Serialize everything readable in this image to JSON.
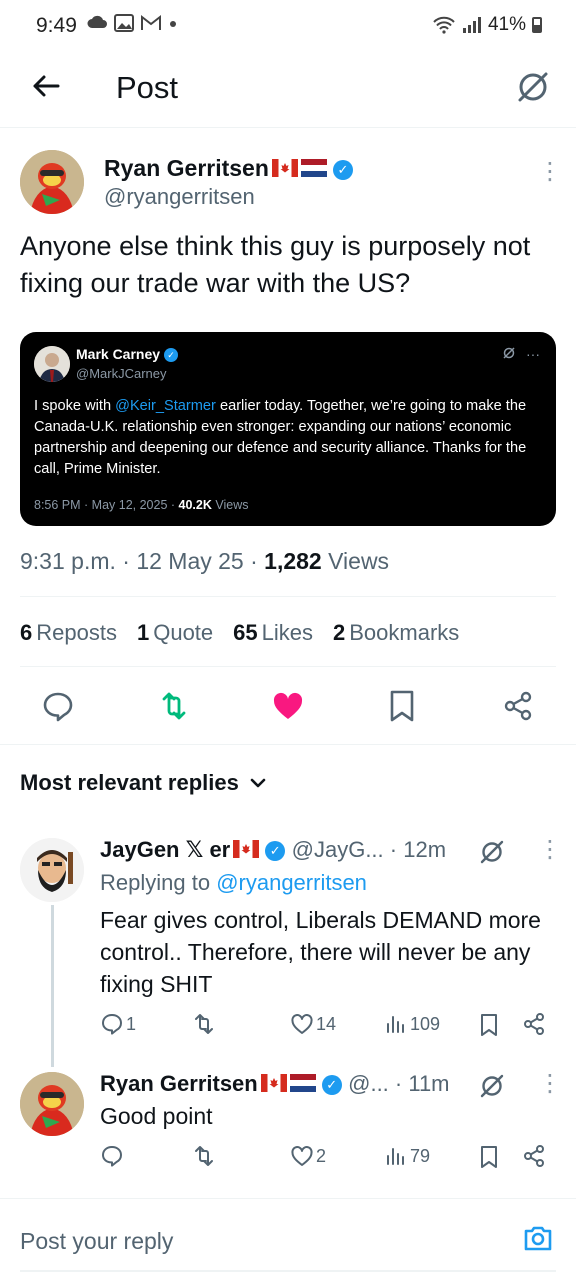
{
  "status_bar": {
    "time": "9:49",
    "battery": "41%",
    "left_icons": [
      "cloud-icon",
      "gallery-icon",
      "gmail-icon",
      "dot-icon"
    ],
    "right_icons": [
      "wifi-icon",
      "signal-icon",
      "battery-icon"
    ]
  },
  "header": {
    "title": "Post"
  },
  "post": {
    "author_name": "Ryan Gerritsen",
    "author_handle": "@ryangerritsen",
    "text": "Anyone else think this guy is purposely not fixing our trade war with the US?",
    "embed": {
      "name": "Mark Carney",
      "handle": "@MarkJCarney",
      "text_before": "I spoke with ",
      "mention": "@Keir_Starmer",
      "text_after": " earlier today. Together, we’re going to make the Canada-U.K. relationship even stronger: expanding our nations’ economic partnership and deepening our defence and security alliance. Thanks for the call, Prime Minister.",
      "meta_prefix": "8:56 PM · May 12, 2025 · ",
      "meta_views_count": "40.2K",
      "meta_views_label": " Views"
    },
    "timestamp": "9:31 p.m. · 12 May 25 · ",
    "views_count": "1,282",
    "views_label": " Views",
    "stats": {
      "reposts_count": "6",
      "reposts_label": "Reposts",
      "quotes_count": "1",
      "quotes_label": "Quote",
      "likes_count": "65",
      "likes_label": "Likes",
      "bookmarks_count": "2",
      "bookmarks_label": "Bookmarks"
    },
    "liked": true,
    "reposted": true
  },
  "replies_sort": {
    "label": "Most relevant replies"
  },
  "replies": [
    {
      "name": "JayGen 𝕏 er",
      "handle": "@JayG...",
      "time": " · 12m",
      "replying_prefix": "Replying to ",
      "replying_to": "@ryangerritsen",
      "text": "Fear gives control, Liberals DEMAND more control.. Therefore, there will never be any fixing SHIT",
      "reply_count": "1",
      "repost_count": "",
      "like_count": "14",
      "view_count": "109"
    },
    {
      "name": "Ryan Gerritsen",
      "handle": "@...",
      "time": " · 11m",
      "text": "Good point",
      "reply_count": "",
      "repost_count": "",
      "like_count": "2",
      "view_count": "79"
    }
  ],
  "composer": {
    "placeholder": "Post your reply"
  },
  "colors": {
    "accent": "#1d9bf0",
    "repost_active": "#00ba7c",
    "like_active": "#f91880",
    "text_primary": "#0f1419",
    "text_secondary": "#536471"
  }
}
